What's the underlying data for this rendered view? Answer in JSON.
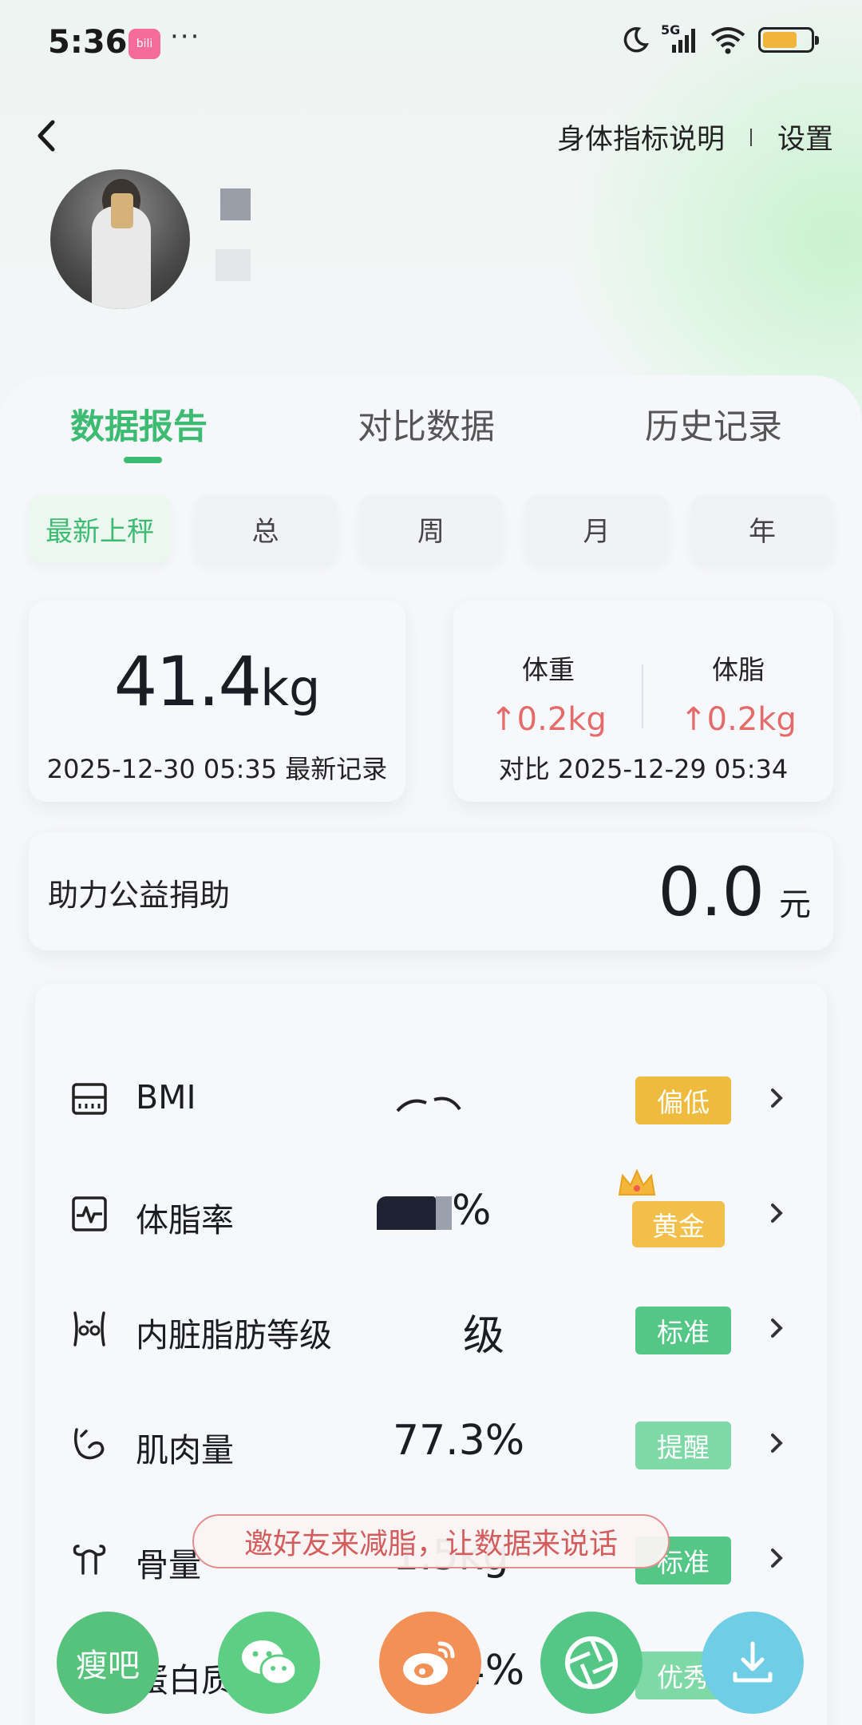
{
  "status_bar": {
    "time": "5:36",
    "dots": "···",
    "app_icon_text": "bili",
    "network": "5G"
  },
  "header": {
    "back_label": "返回",
    "links": [
      "身体指标说明",
      "设置"
    ]
  },
  "tabs": [
    "数据报告",
    "对比数据",
    "历史记录"
  ],
  "periods": [
    "最新上秤",
    "总",
    "周",
    "月",
    "年"
  ],
  "latest": {
    "weight": "41.4",
    "unit": "kg",
    "date": "2025-12-30 05:35 最新记录"
  },
  "compare": {
    "weight_label": "体重",
    "weight_change": "↑0.2kg",
    "fat_label": "体脂",
    "fat_change": "↑0.2kg",
    "date": "对比 2025-12-29 05:34"
  },
  "donation": {
    "label": "助力公益捐助",
    "value": "0.0",
    "unit": "元"
  },
  "metrics": [
    {
      "name": "BMI",
      "value": "",
      "badge": "偏低",
      "badge_color": "#efbb3e"
    },
    {
      "name": "体脂率",
      "value": "%",
      "badge": "黄金",
      "badge_color": "#f2c04a"
    },
    {
      "name": "内脏脂肪等级",
      "value": "级",
      "badge": "标准",
      "badge_color": "#54c787"
    },
    {
      "name": "肌肉量",
      "value": "77.3%",
      "badge": "提醒",
      "badge_color": "#7ed9a6"
    },
    {
      "name": "骨量",
      "value": "1.5kg",
      "badge": "标准",
      "badge_color": "#54c787"
    },
    {
      "name": "蛋白质",
      "value": "20.4%",
      "badge": "优秀",
      "badge_color": "#7ed9a6"
    }
  ],
  "invite_banner": "邀好友来减脂，让数据来说话",
  "share": [
    {
      "name": "瘦吧",
      "label": "瘦吧",
      "color": "#56c27c"
    },
    {
      "name": "wechat",
      "label": "",
      "color": "#5ccf84"
    },
    {
      "name": "weibo",
      "label": "",
      "color": "#f39056"
    },
    {
      "name": "moments",
      "label": "",
      "color": "#54c787"
    },
    {
      "name": "download",
      "label": "",
      "color": "#6fcde6"
    }
  ],
  "colors": {
    "accent": "#3dbb72",
    "up_red": "#e56b6b"
  }
}
